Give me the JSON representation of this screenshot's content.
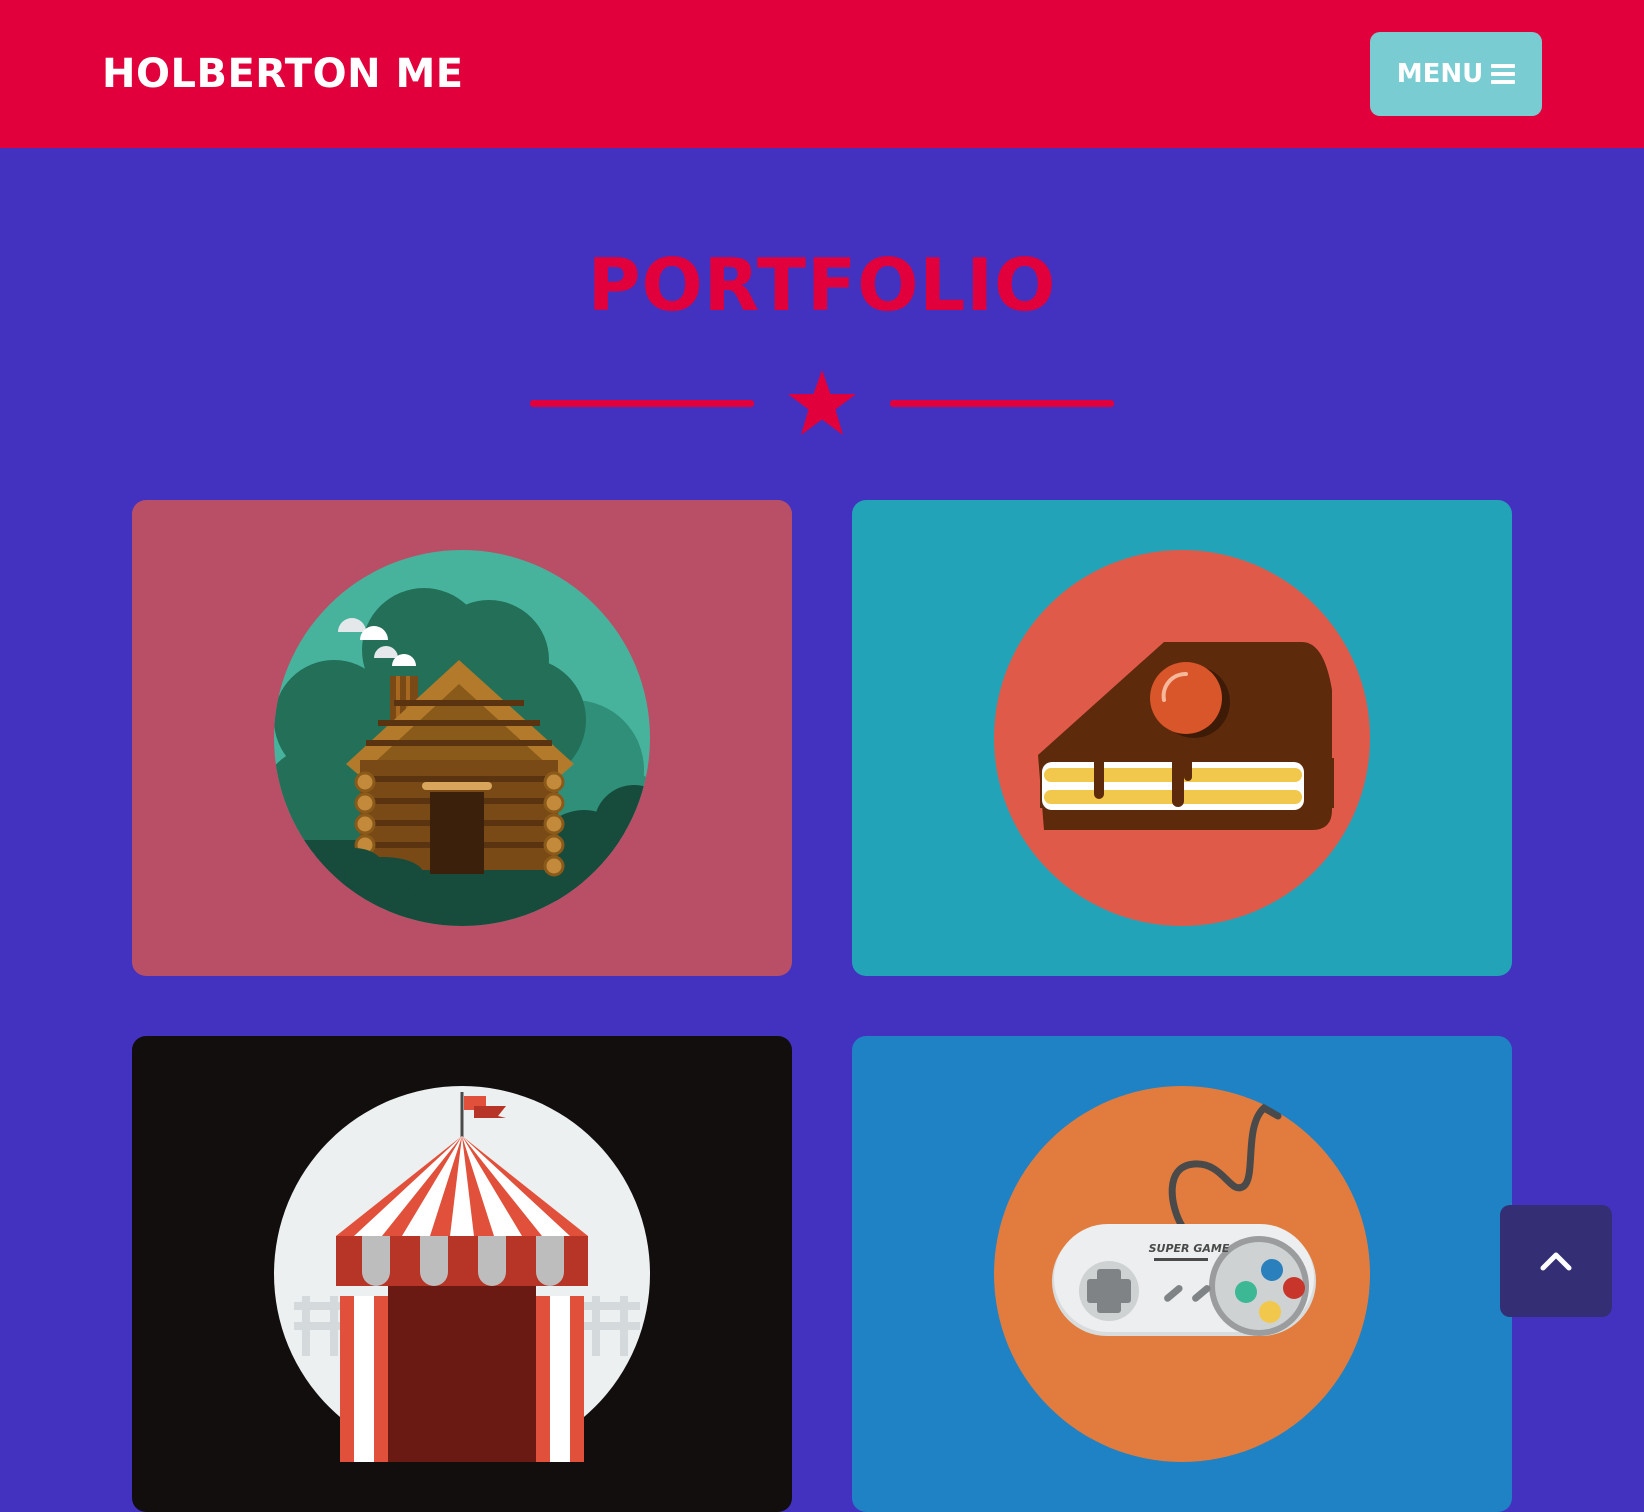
{
  "nav": {
    "brand": "HOLBERTON ME",
    "menu_label": "MENU",
    "menu_icon": "hamburger-icon"
  },
  "portfolio": {
    "title": "PORTFOLIO",
    "divider_icon": "star-icon",
    "items": [
      {
        "name": "cabin",
        "icon": "cabin-icon",
        "background": "#b94f66",
        "circle": "#47b39c"
      },
      {
        "name": "cake",
        "icon": "cake-icon",
        "background": "#22a3b8",
        "circle": "#e05a4a"
      },
      {
        "name": "circus",
        "icon": "circus-tent-icon",
        "background": "#120e0e",
        "circle": "#ecf0f1"
      },
      {
        "name": "game",
        "icon": "game-controller-icon",
        "background": "#1e82c4",
        "circle": "#e27c3e",
        "controller_text": "SUPER GAME"
      }
    ]
  },
  "scroll_top": {
    "icon": "chevron-up-icon"
  },
  "colors": {
    "navbar": "#e1003b",
    "page": "#4232bf",
    "menu_button": "#78ccd2",
    "accent": "#e1003b",
    "scroll_button": "#342f75"
  }
}
